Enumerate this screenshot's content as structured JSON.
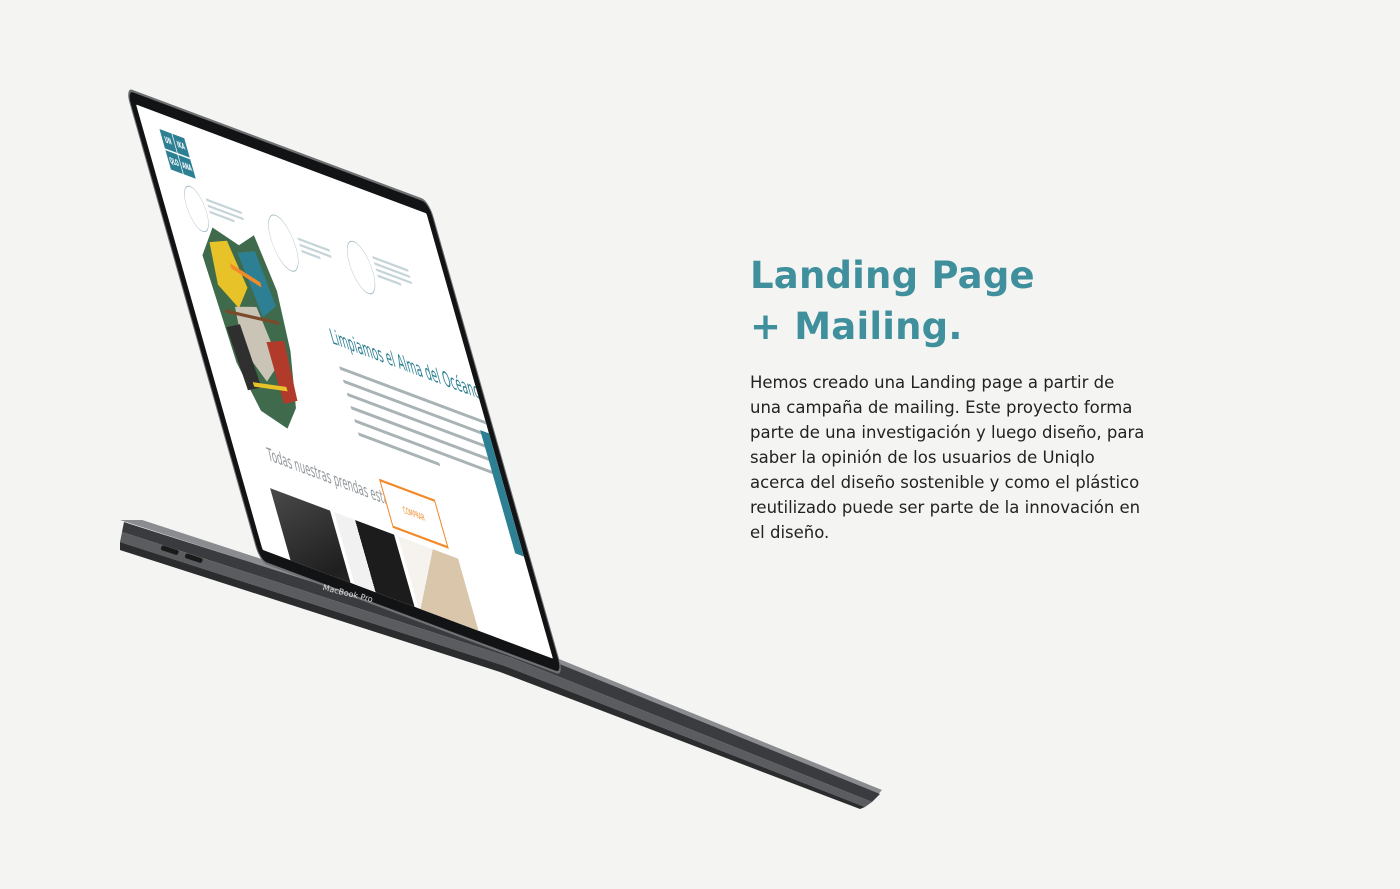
{
  "heading": {
    "line1": "Landing Page",
    "line2": "+ Mailing."
  },
  "description": {
    "lines": [
      "Hemos creado una Landing page a partir de",
      "una campaña de mailing. Este proyecto forma",
      "parte de una investigación y luego diseño, para",
      "saber la opinión de los usuarios de Uniqlo",
      "acerca del diseño sostenible y como el plástico",
      "reutilizado puede ser parte de la innovación en",
      "el diseño."
    ]
  },
  "laptop": {
    "brand": "MacBook Pro",
    "landing": {
      "logo": [
        "UN",
        "IKA",
        "QLO",
        "ANA"
      ],
      "heading": "Limpiamos el Alma del Océano",
      "cta_label": "COMPRAR",
      "subtitle": "Todas nuestras prendas están"
    }
  },
  "colors": {
    "accent": "#3f8f9c",
    "cta": "#f08a2a",
    "background": "#f4f4f3"
  }
}
